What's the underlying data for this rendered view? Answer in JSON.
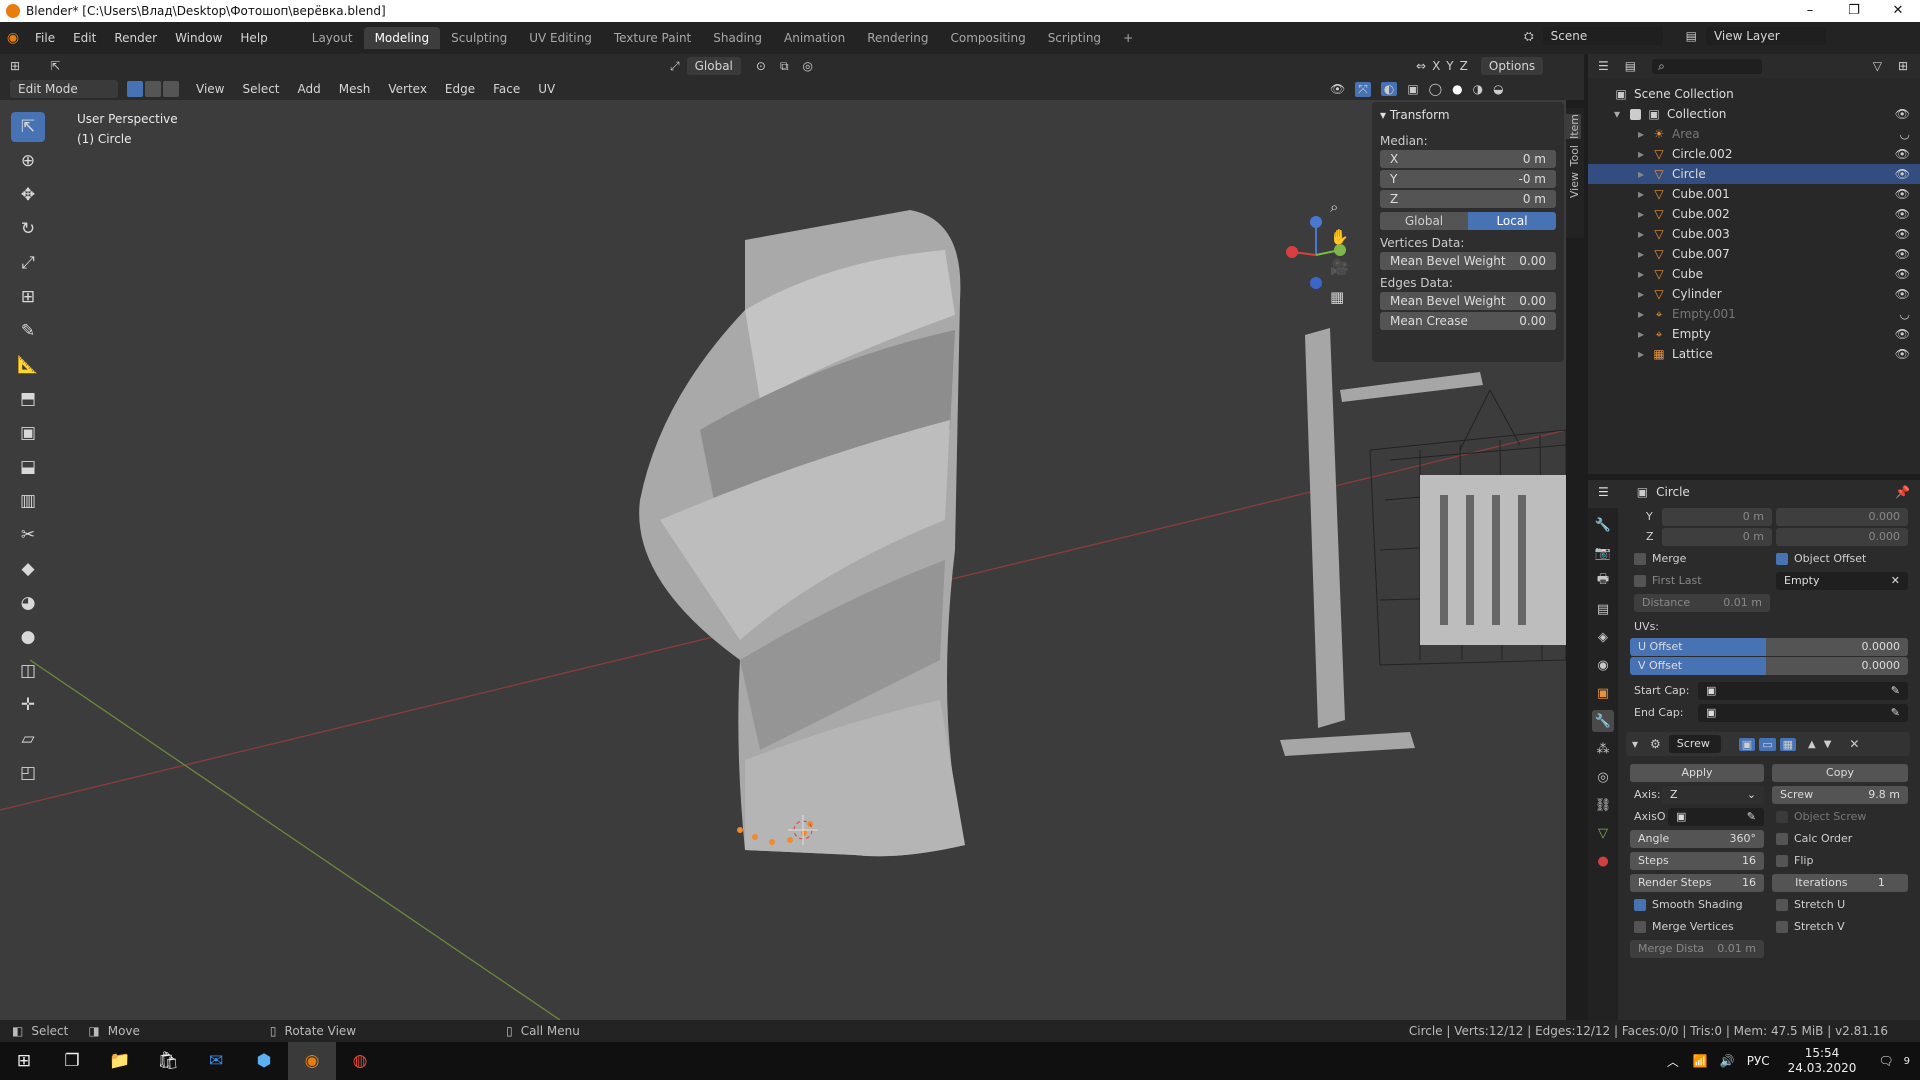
{
  "window": {
    "title": "Blender* [C:\\Users\\Влад\\Desktop\\Фотошоп\\верёвка.blend]"
  },
  "menu": {
    "items": [
      "File",
      "Edit",
      "Render",
      "Window",
      "Help"
    ]
  },
  "workspaces": [
    "Layout",
    "Modeling",
    "Sculpting",
    "UV Editing",
    "Texture Paint",
    "Shading",
    "Animation",
    "Rendering",
    "Compositing",
    "Scripting"
  ],
  "active_workspace": "Modeling",
  "scene": {
    "name": "Scene",
    "view_layer": "View Layer"
  },
  "toolrow": {
    "orientation": "Global",
    "axes": [
      "X",
      "Y",
      "Z"
    ],
    "options": "Options"
  },
  "header": {
    "mode": "Edit Mode",
    "items": [
      "View",
      "Select",
      "Add",
      "Mesh",
      "Vertex",
      "Edge",
      "Face",
      "UV"
    ]
  },
  "viewport": {
    "perspective": "User Perspective",
    "object": "(1) Circle"
  },
  "npanel": {
    "section": "Transform",
    "median": "Median:",
    "x": {
      "label": "X",
      "value": "0 m"
    },
    "y": {
      "label": "Y",
      "value": "-0 m"
    },
    "z": {
      "label": "Z",
      "value": "0 m"
    },
    "global": "Global",
    "local": "Local",
    "vertices_data": "Vertices Data:",
    "mean_bevel_v": {
      "label": "Mean Bevel Weight",
      "value": "0.00"
    },
    "edges_data": "Edges Data:",
    "mean_bevel_e": {
      "label": "Mean Bevel Weight",
      "value": "0.00"
    },
    "mean_crease": {
      "label": "Mean Crease",
      "value": "0.00"
    },
    "tabs": [
      "Item",
      "Tool",
      "View"
    ]
  },
  "outliner": {
    "root": "Scene Collection",
    "collection": "Collection",
    "items": [
      {
        "name": "Area",
        "icon": "light-icon",
        "dim": true
      },
      {
        "name": "Circle.002",
        "icon": "mesh-icon"
      },
      {
        "name": "Circle",
        "icon": "mesh-icon"
      },
      {
        "name": "Cube.001",
        "icon": "mesh-icon"
      },
      {
        "name": "Cube.002",
        "icon": "mesh-icon"
      },
      {
        "name": "Cube.003",
        "icon": "mesh-icon"
      },
      {
        "name": "Cube.007",
        "icon": "mesh-icon"
      },
      {
        "name": "Cube",
        "icon": "mesh-icon"
      },
      {
        "name": "Cylinder",
        "icon": "mesh-icon"
      },
      {
        "name": "Empty.001",
        "icon": "empty-icon",
        "dim": true
      },
      {
        "name": "Empty",
        "icon": "empty-icon"
      },
      {
        "name": "Lattice",
        "icon": "lattice-icon"
      }
    ]
  },
  "properties": {
    "object": "Circle",
    "y": {
      "label": "Y",
      "value": "0 m",
      "value2": "0.000"
    },
    "z": {
      "label": "Z",
      "value": "0 m",
      "value2": "0.000"
    },
    "merge": "Merge",
    "object_offset": "Object Offset",
    "first_last": "First Last",
    "offset_object": "Empty",
    "distance": {
      "label": "Distance",
      "value": "0.01 m"
    },
    "uvs": "UVs:",
    "u_offset": {
      "label": "U Offset",
      "value": "0.0000"
    },
    "v_offset": {
      "label": "V Offset",
      "value": "0.0000"
    },
    "start_cap": "Start Cap:",
    "end_cap": "End Cap:",
    "modifier": "Screw",
    "apply": "Apply",
    "copy": "Copy",
    "axis": {
      "label": "Axis:",
      "value": "Z"
    },
    "screw": {
      "label": "Screw",
      "value": "9.8 m"
    },
    "axis_o": "AxisO",
    "object_screw": "Object Screw",
    "angle": {
      "label": "Angle",
      "value": "360°"
    },
    "calc_order": "Calc Order",
    "steps": {
      "label": "Steps",
      "value": "16"
    },
    "flip": "Flip",
    "render_steps": {
      "label": "Render Steps",
      "value": "16"
    },
    "iterations": {
      "label": "Iterations",
      "value": "1"
    },
    "smooth_shading": "Smooth Shading",
    "stretch_u": "Stretch U",
    "merge_vertices": "Merge Vertices",
    "stretch_v": "Stretch V",
    "merge_dist": {
      "label": "Merge Dista",
      "value": "0.01 m"
    }
  },
  "status": {
    "select": "Select",
    "move": "Move",
    "rotate": "Rotate View",
    "call_menu": "Call Menu",
    "stats": "Circle | Verts:12/12 | Edges:12/12 | Faces:0/0 | Tris:0 | Mem: 47.5 MiB | v2.81.16"
  },
  "taskbar": {
    "time": "15:54",
    "date": "24.03.2020",
    "lang": "РУС",
    "notifications": "9"
  },
  "colors": {
    "accent": "#4772b3",
    "viewport": "#3c3c3c",
    "mesh": "#a8a8a8",
    "orange": "#e8923c"
  }
}
